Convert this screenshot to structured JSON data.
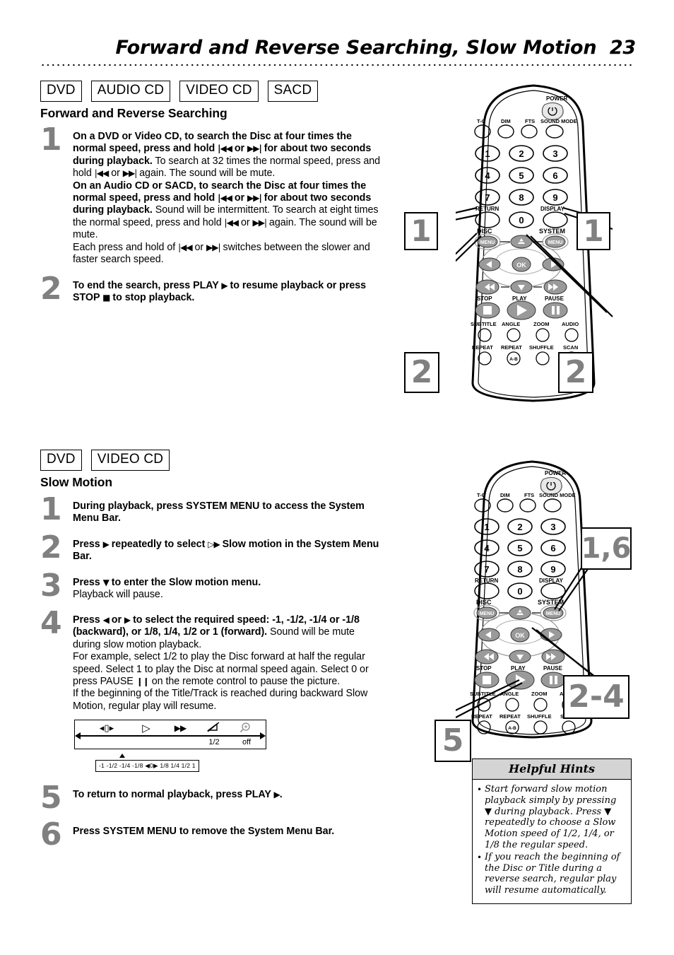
{
  "page": {
    "title": "Forward and Reverse Searching, Slow Motion",
    "number": "23"
  },
  "section1": {
    "badges": [
      "DVD",
      "AUDIO CD",
      "VIDEO CD",
      "SACD"
    ],
    "heading": "Forward and Reverse Searching",
    "steps": [
      {
        "num": "1",
        "html": "<b>On a DVD or Video CD, to search the Disc at four times the normal speed, press and hold <span class='gl'>|◀◀</span> or <span class='gl'>▶▶|</span> for about two seconds during playback.</b> To search at 32 times the normal speed, press and hold <span class='gl'>|◀◀</span> or <span class='gl'>▶▶|</span> again. The sound will be mute.<br><b>On an Audio CD or SACD, to search the Disc at four times the normal speed, press and hold <span class='gl'>|◀◀</span> or <span class='gl'>▶▶|</span> for about two seconds during playback.</b> Sound will be intermittent. To search at eight times the normal speed, press and hold <span class='gl'>|◀◀</span> or <span class='gl'>▶▶|</span> again. The sound will be mute.<br>Each press and hold of <span class='gl'>|◀◀</span> or <span class='gl'>▶▶|</span> switches between the slower and faster search speed."
      },
      {
        "num": "2",
        "html": "<b>To end the search, press PLAY <span class='gl'>▶</span> to resume playback or press STOP <span class='gl'>■</span> to stop playback.</b>"
      }
    ]
  },
  "section2": {
    "badges": [
      "DVD",
      "VIDEO CD"
    ],
    "heading": "Slow Motion",
    "steps": [
      {
        "num": "1",
        "html": "<b>During playback, press SYSTEM MENU to access the System Menu Bar.</b>"
      },
      {
        "num": "2",
        "html": "<b>Press <span class='gl'>▶</span> repeatedly to select <span class='gl'>▷▶</span> Slow motion in the System Menu Bar.</b>"
      },
      {
        "num": "3",
        "html": "<b>Press <span class='gl'>▼</span> to enter the Slow motion menu.</b><br>Playback will pause."
      },
      {
        "num": "4",
        "html": "<b>Press <span class='gl'>◀</span> or <span class='gl'>▶</span> to select the required speed: -1, -1/2, -1/4 or -1/8 (backward), or 1/8, 1/4, 1/2 or 1 (forward).</b> Sound will be mute during slow motion playback.<br>For example, select 1/2 to play the Disc forward at half the regular speed. Select 1 to play the Disc at normal speed again. Select 0 or press PAUSE <span class='gl'>❙❙</span> on the remote control to pause the picture.<br>If the beginning of the Title/Track is reached during backward Slow Motion, regular play will resume."
      },
      {
        "num": "5",
        "html": "<b>To return to normal playback, press PLAY <span class='gl'>▶</span>.</b>"
      },
      {
        "num": "6",
        "html": "<b>Press SYSTEM MENU to remove the System Menu Bar.</b>"
      }
    ]
  },
  "menu_bar_figure": {
    "items": [
      {
        "icon": "frame-step-icon",
        "glyph": "◂▯▸",
        "value": ""
      },
      {
        "icon": "slow-motion-icon",
        "glyph": "▷",
        "value": ""
      },
      {
        "icon": "fast-forward-icon",
        "glyph": "▶▶",
        "value": ""
      },
      {
        "icon": "sound-mute-icon",
        "glyph": "",
        "value": "1/2"
      },
      {
        "icon": "zoom-icon",
        "glyph": "",
        "value": "off"
      }
    ],
    "scale": "-1  -1/2  -1/4  -1/8  ◀0▶  1/8  1/4  1/2  1"
  },
  "hints": {
    "title": "Helpful Hints",
    "items": [
      "Start forward slow motion playback simply by pressing ▼ during playback. Press ▼ repeatedly to choose a Slow Motion speed of 1/2, 1/4, or 1/8 the regular speed.",
      "If you reach the beginning of the Disc or Title during a reverse search, regular play will resume automatically."
    ]
  },
  "remote": {
    "labels": {
      "power": "POWER",
      "tc": "T-C",
      "dim": "DIM",
      "fts": "FTS",
      "sound_mode": "SOUND MODE",
      "return": "RETURN",
      "display": "DISPLAY",
      "disc": "DISC",
      "system": "SYSTEM",
      "menu": "MENU",
      "ok": "OK",
      "stop": "STOP",
      "play": "PLAY",
      "pause": "PAUSE",
      "subtitle": "SUBTITLE",
      "angle": "ANGLE",
      "zoom": "ZOOM",
      "audio": "AUDIO",
      "repeat": "REPEAT",
      "repeat_ab": "REPEAT",
      "ab": "A-B",
      "shuffle": "SHUFFLE",
      "scan": "SCAN"
    },
    "keypad": [
      "1",
      "2",
      "3",
      "4",
      "5",
      "6",
      "7",
      "8",
      "9",
      "0"
    ]
  },
  "callouts": {
    "remote1": [
      {
        "name": "callout-1-left",
        "text": "1"
      },
      {
        "name": "callout-1-right",
        "text": "1"
      },
      {
        "name": "callout-2-left",
        "text": "2"
      },
      {
        "name": "callout-2-right",
        "text": "2"
      }
    ],
    "remote2": [
      {
        "name": "callout-1-6",
        "text": "1,6"
      },
      {
        "name": "callout-2-4",
        "text": "2-4"
      },
      {
        "name": "callout-5",
        "text": "5"
      }
    ]
  }
}
